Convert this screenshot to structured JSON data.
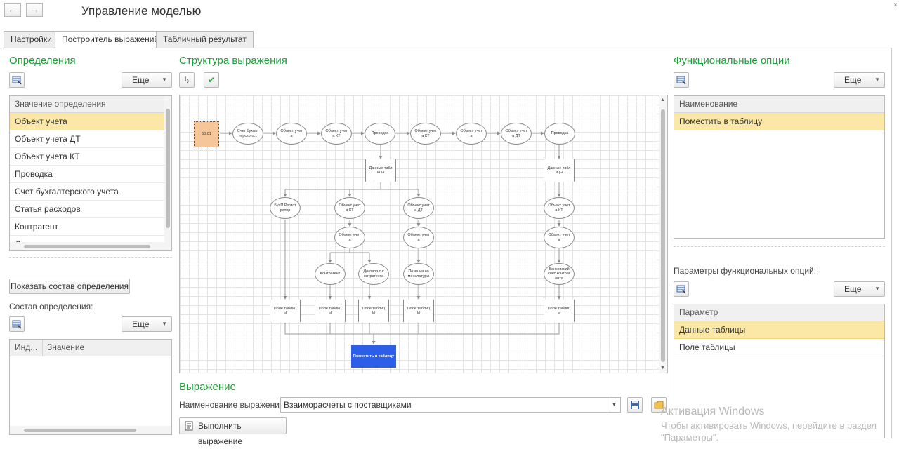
{
  "window": {
    "title": "Управление моделью",
    "back_glyph": "←",
    "forward_glyph": "→",
    "close_glyph": "×"
  },
  "tabs": [
    {
      "label": "Настройки"
    },
    {
      "label": "Построитель выражений"
    },
    {
      "label": "Табличный результат"
    }
  ],
  "definitions": {
    "heading": "Определения",
    "more_label": "Еще",
    "column_header": "Значение определения",
    "items": [
      "Объект учета",
      "Объект учета ДТ",
      "Объект учета КТ",
      "Проводка",
      "Счет бухгалтерского учета",
      "Статья расходов",
      "Контрагент",
      "Договор с контрагентом"
    ],
    "selected_index": 0,
    "show_button": "Показать состав определения",
    "composition_label": "Состав определения:",
    "composition_more": "Еще",
    "composition_columns": [
      "Инд...",
      "Значение"
    ]
  },
  "structure": {
    "heading": "Структура выражения",
    "arrow_glyph": "↳",
    "check_glyph": "✔",
    "nodes": {
      "n6001": "60.01",
      "n_sbu": "Счет бухгалтерского...",
      "n_ou1": "Объект учета",
      "n_oukt1": "Объект учета КТ",
      "n_pr1": "Проводка",
      "n_oukt2": "Объект учета КТ",
      "n_ou2": "Объект учета",
      "n_oudt1": "Объект учета ДТ",
      "n_pr2": "Проводка",
      "n_dt1": "Данные таблицы",
      "n_dt2": "Данные таблицы",
      "n_bukh": "БухП.Регистратор",
      "n_oukt3": "Объект учета КТ",
      "n_oudt2": "Объект учета ДТ",
      "n_oukt4": "Объект учета КТ",
      "n_ou3": "Объект учета",
      "n_ou4": "Объект учета",
      "n_ou5": "Объект учета",
      "n_kontr": "Контрагент",
      "n_dog": "Договор с контрагента",
      "n_poz": "Позиция номенклатуры",
      "n_bank": "Банковский счет контрагента",
      "n_pt1": "Поле таблицы",
      "n_pt2": "Поле таблицы",
      "n_pt3": "Поле таблицы",
      "n_pt4": "Поле таблицы",
      "n_pt5": "Поле таблицы",
      "n_final": "Поместить в таблицу"
    }
  },
  "expression": {
    "heading": "Выражение",
    "name_label": "Наименование выражения:",
    "name_value": "Взаиморасчеты с поставщиками",
    "run_button": "Выполнить выражение"
  },
  "functional_options": {
    "heading": "Функциональные опции",
    "more_label": "Еще",
    "column_header": "Наименование",
    "items": [
      "Поместить в таблицу"
    ],
    "params_label": "Параметры функциональных опций:",
    "params_more": "Еще",
    "params_column": "Параметр",
    "params_items": [
      "Данные таблицы",
      "Поле таблицы"
    ]
  },
  "watermark": {
    "line1": "Активация Windows",
    "line2": "Чтобы активировать Windows, перейдите в раздел",
    "line3": "\"Параметры\"."
  },
  "colors": {
    "heading_green": "#1f9e3a",
    "selected_row": "#fbe8a6",
    "final_node": "#2d5ee8",
    "start_node": "#f6c69b"
  }
}
